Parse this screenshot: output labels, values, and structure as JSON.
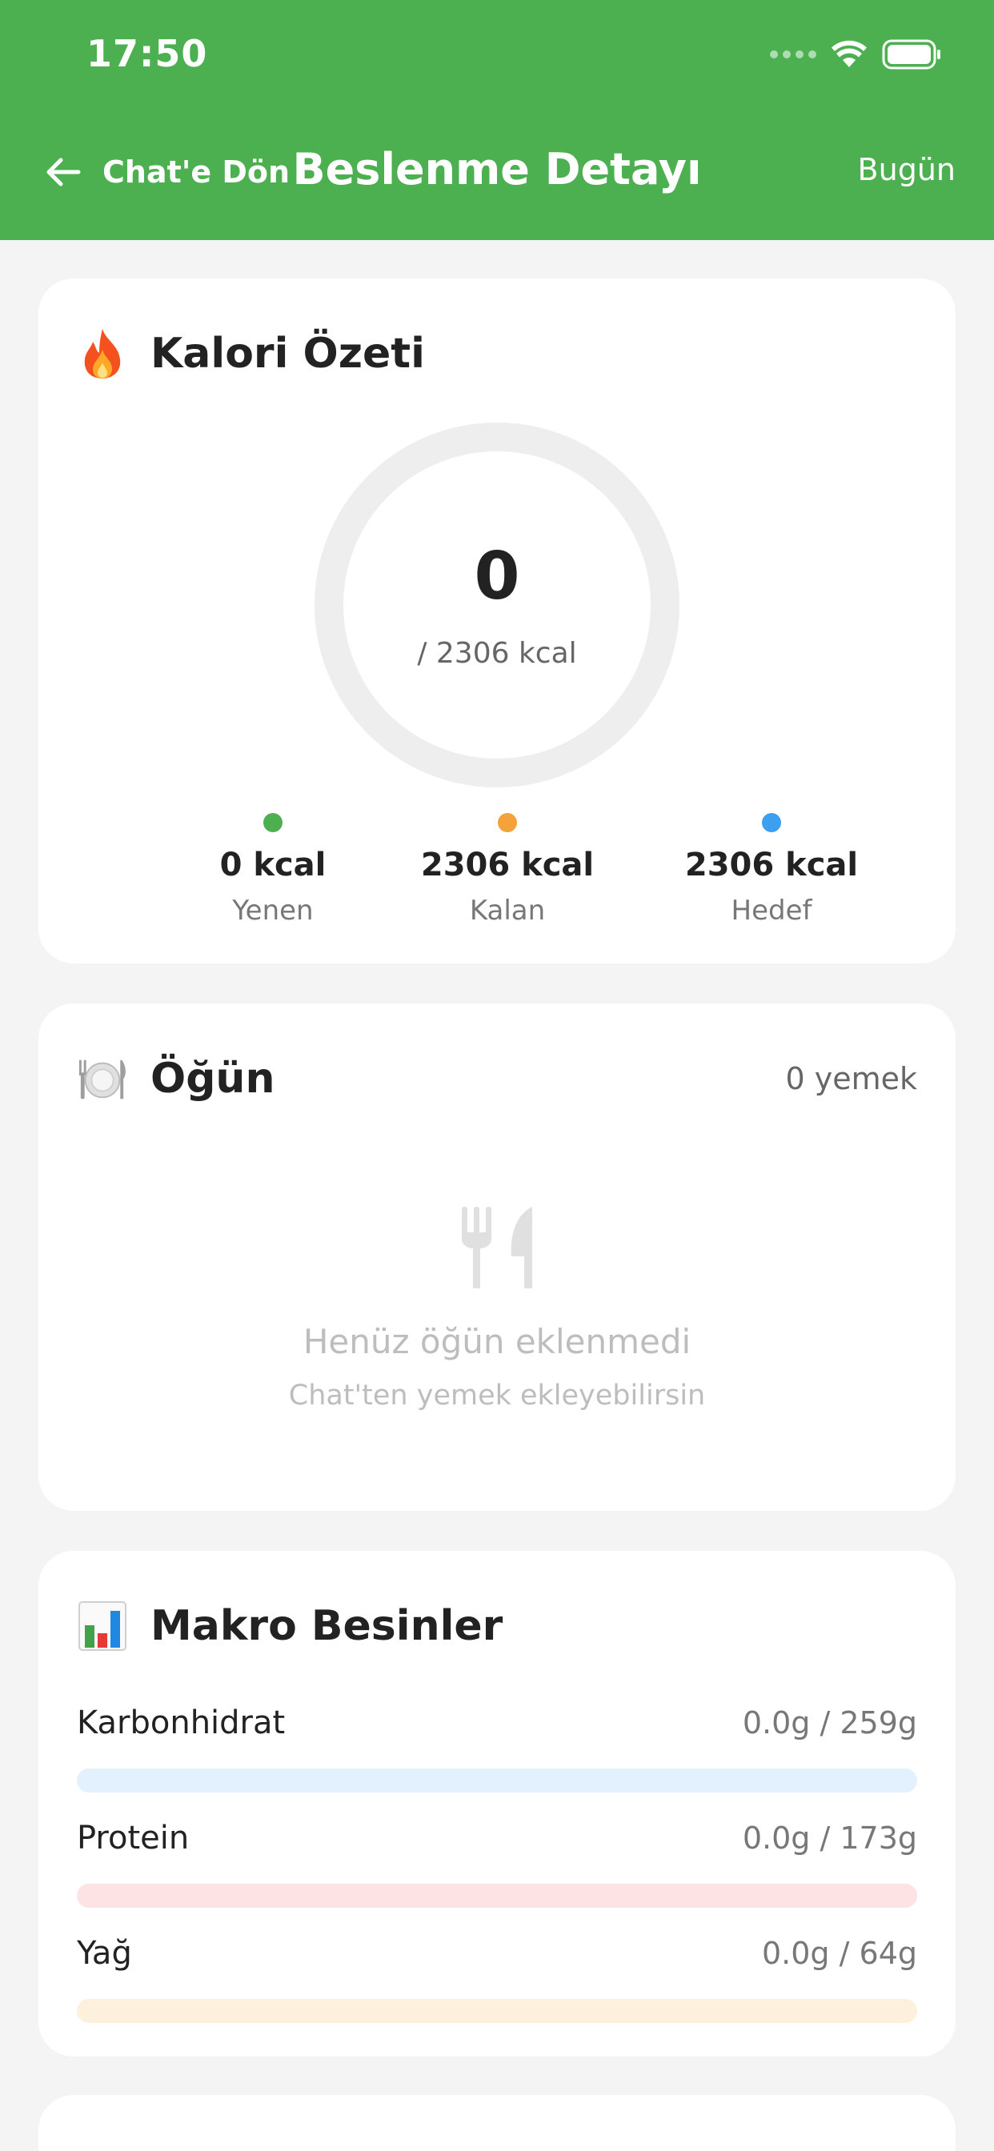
{
  "status_bar": {
    "time": "17:50"
  },
  "nav": {
    "back_label": "Chat'e Dön",
    "title": "Beslenme Detayı",
    "date_label": "Bugün"
  },
  "calorie_summary": {
    "title": "Kalori Özeti",
    "icon": "fire-icon",
    "consumed": "0",
    "target_text": "/ 2306 kcal",
    "progress": 0,
    "stats": [
      {
        "value": "0 kcal",
        "label": "Yenen",
        "color": "#4caf50"
      },
      {
        "value": "2306 kcal",
        "label": "Kalan",
        "color": "#f6a23a"
      },
      {
        "value": "2306 kcal",
        "label": "Hedef",
        "color": "#3d9ff0"
      }
    ]
  },
  "meals": {
    "title": "Öğün",
    "icon": "plate-icon",
    "count_label": "0 yemek",
    "empty_title": "Henüz öğün eklenmedi",
    "empty_subtitle": "Chat'ten yemek ekleyebilirsin"
  },
  "macros": {
    "title": "Makro Besinler",
    "icon": "bar-chart-icon",
    "items": [
      {
        "name": "Karbonhidrat",
        "amount": "0.0g / 259g",
        "progress": 0,
        "track_color": "#e3f0fd",
        "fill_color": "#3d9ff0"
      },
      {
        "name": "Protein",
        "amount": "0.0g / 173g",
        "progress": 0,
        "track_color": "#fde3e3",
        "fill_color": "#ef5350"
      },
      {
        "name": "Yağ",
        "amount": "0.0g / 64g",
        "progress": 0,
        "track_color": "#fdf0dc",
        "fill_color": "#f6a23a"
      }
    ]
  },
  "colors": {
    "header": "#4caf50",
    "background": "#f4f4f4"
  }
}
